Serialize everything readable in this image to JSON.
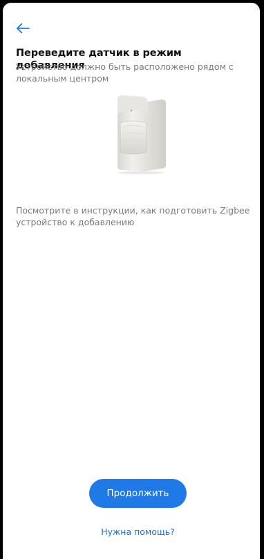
{
  "header": {
    "back_icon": "arrow-left-icon"
  },
  "main": {
    "title": "Переведите датчик в режим добавления",
    "subtitle": "Устройство должно быть расположено рядом с локальным центром",
    "image": "motion-sensor-image",
    "hint": "Посмотрите в инструкции, как подготовить Zigbee устройство к добавлению"
  },
  "actions": {
    "continue_label": "Продолжить",
    "help_label": "Нужна помощь?"
  },
  "colors": {
    "accent": "#1f7ae8",
    "link": "#1f6fd6",
    "title": "#111111",
    "secondary_text": "#7a7a7a",
    "background": "#ffffff"
  }
}
